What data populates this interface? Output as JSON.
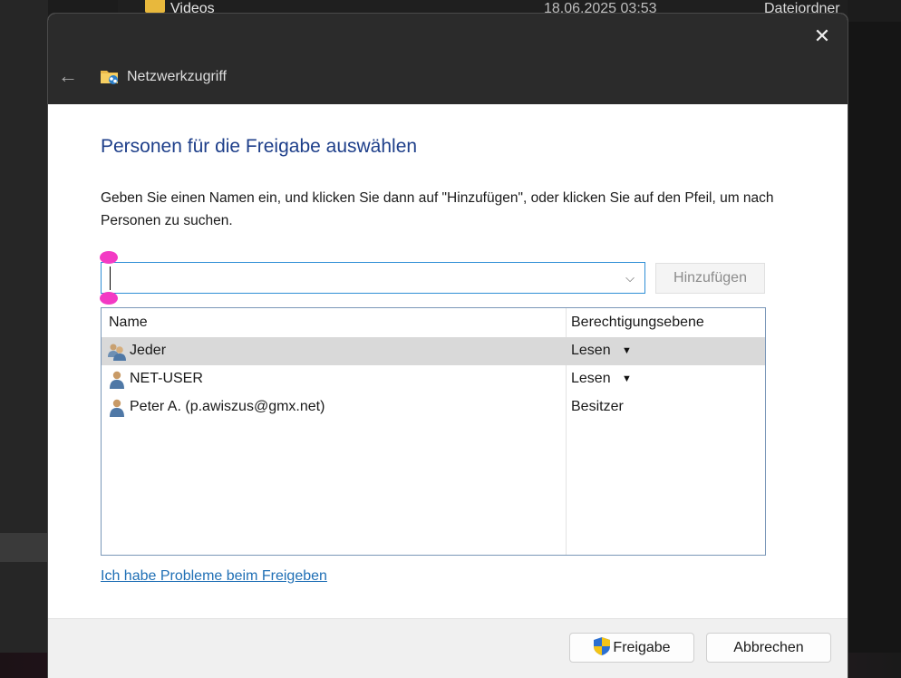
{
  "background": {
    "row": {
      "name": "Videos",
      "date": "18.06.2025 03:53",
      "type": "Dateiordner"
    }
  },
  "dialog": {
    "title": "Netzwerkzugriff",
    "close_glyph": "✕",
    "back_glyph": "←",
    "heading": "Personen für die Freigabe auswählen",
    "description": "Geben Sie einen Namen ein, und klicken Sie dann auf \"Hinzufügen\", oder klicken Sie auf den Pfeil, um nach Personen zu suchen.",
    "input": {
      "value": "",
      "dropdown_glyph": "⌵"
    },
    "add_button": "Hinzufügen",
    "table": {
      "headers": {
        "name": "Name",
        "permission": "Berechtigungsebene"
      },
      "rows": [
        {
          "name": "Jeder",
          "permission": "Lesen",
          "dropdown": "▼",
          "icon": "group-icon",
          "selected": true
        },
        {
          "name": "NET-USER",
          "permission": "Lesen",
          "dropdown": "▼",
          "icon": "user-icon",
          "selected": false
        },
        {
          "name": "Peter A. (p.awiszus@gmx.net)",
          "permission": "Besitzer",
          "dropdown": "",
          "icon": "user-icon",
          "selected": false
        }
      ]
    },
    "help_link": "Ich habe Probleme beim Freigeben",
    "share_button": "Freigabe",
    "cancel_button": "Abbrechen"
  },
  "colors": {
    "heading": "#1e3f8a",
    "link": "#1f6fb5",
    "input_border": "#2f8fd6",
    "selection_handles": "#f33ac4",
    "selected_row": "#d9d9d9"
  }
}
